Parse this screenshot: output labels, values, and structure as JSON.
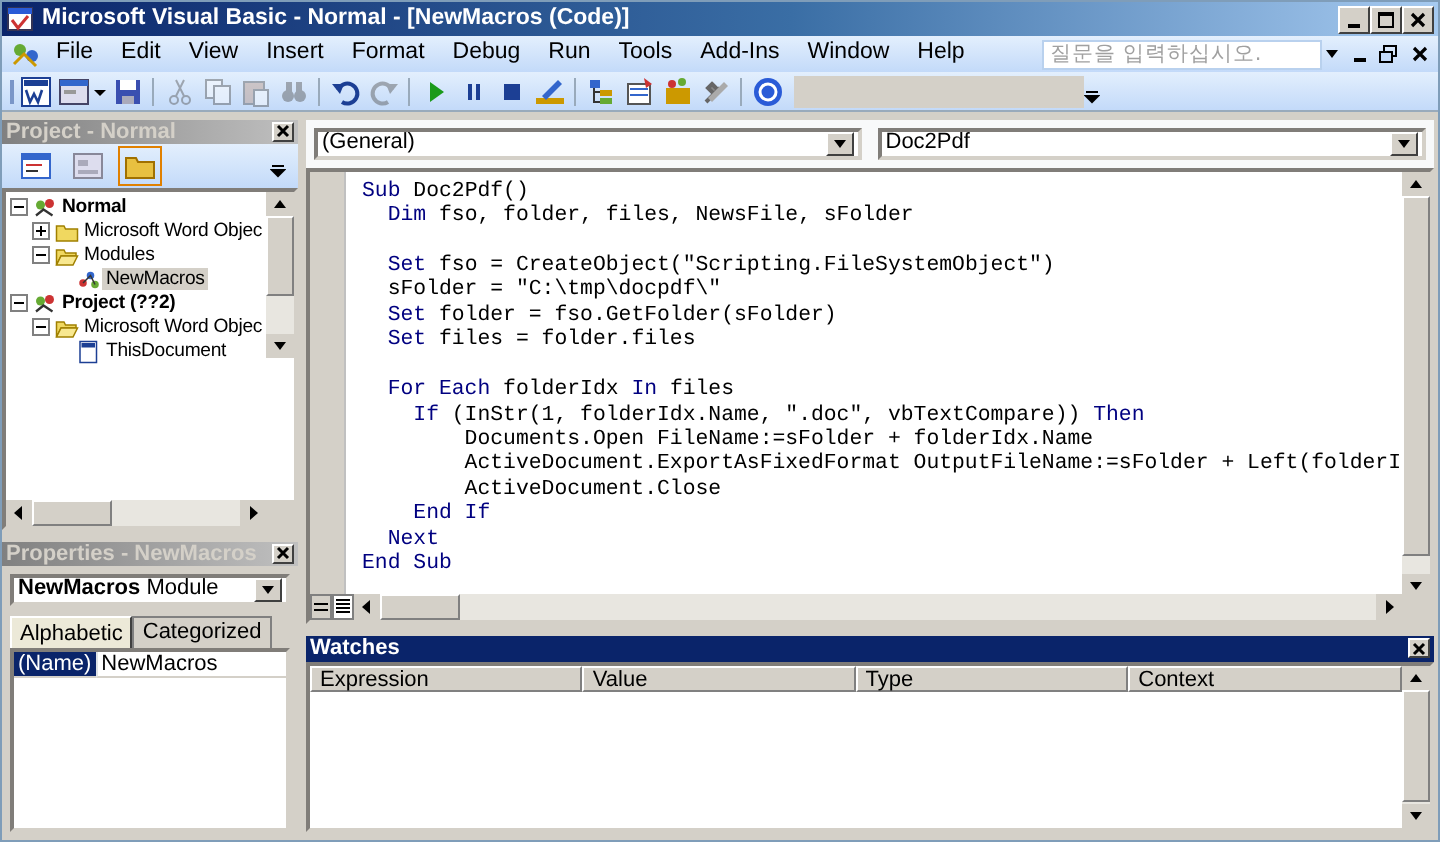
{
  "window": {
    "title": "Microsoft Visual Basic - Normal - [NewMacros (Code)]"
  },
  "menu": [
    "File",
    "Edit",
    "View",
    "Insert",
    "Format",
    "Debug",
    "Run",
    "Tools",
    "Add-Ins",
    "Window",
    "Help"
  ],
  "help_search": {
    "placeholder": "질문을 입력하십시오."
  },
  "toolbar": [
    {
      "kind": "word",
      "disabled": false
    },
    {
      "kind": "form",
      "disabled": false
    },
    {
      "kind": "save",
      "disabled": false
    },
    {
      "kind": "sep"
    },
    {
      "kind": "cut",
      "disabled": true
    },
    {
      "kind": "copy",
      "disabled": true
    },
    {
      "kind": "paste",
      "disabled": true
    },
    {
      "kind": "find",
      "disabled": true
    },
    {
      "kind": "sep"
    },
    {
      "kind": "undo",
      "disabled": false
    },
    {
      "kind": "redo",
      "disabled": true
    },
    {
      "kind": "sep"
    },
    {
      "kind": "run",
      "disabled": false
    },
    {
      "kind": "pause",
      "disabled": false
    },
    {
      "kind": "stop",
      "disabled": false
    },
    {
      "kind": "design",
      "disabled": false
    },
    {
      "kind": "sep"
    },
    {
      "kind": "explorer",
      "disabled": false
    },
    {
      "kind": "properties",
      "disabled": false
    },
    {
      "kind": "browser",
      "disabled": false
    },
    {
      "kind": "toolbox",
      "disabled": false
    },
    {
      "kind": "sep"
    },
    {
      "kind": "help",
      "disabled": false
    }
  ],
  "project_pane": {
    "title": "Project - Normal",
    "buttons": [
      {
        "kind": "view-code",
        "pressed": false
      },
      {
        "kind": "view-object",
        "pressed": false
      },
      {
        "kind": "toggle-folders",
        "pressed": true
      }
    ],
    "tree": [
      {
        "label": "Normal",
        "kind": "project",
        "expanded": true,
        "selected": false,
        "children": [
          {
            "label": "Microsoft Word Objec",
            "kind": "folder",
            "expanded": false,
            "selected": false
          },
          {
            "label": "Modules",
            "kind": "folder",
            "expanded": true,
            "selected": false,
            "children": [
              {
                "label": "NewMacros",
                "kind": "module",
                "selected": true
              }
            ]
          }
        ]
      },
      {
        "label": "Project (??2)",
        "kind": "project",
        "expanded": true,
        "selected": false,
        "children": [
          {
            "label": "Microsoft Word Objec",
            "kind": "folder",
            "expanded": true,
            "selected": false,
            "children": [
              {
                "label": "ThisDocument",
                "kind": "document",
                "selected": false
              }
            ]
          }
        ]
      }
    ]
  },
  "properties_pane": {
    "title": "Properties - NewMacros",
    "object": "**NewMacros** Module",
    "tabs": [
      {
        "label": "Alphabetic",
        "selected": true
      },
      {
        "label": "Categorized",
        "selected": false
      }
    ],
    "rows": [
      {
        "name": "(Name)",
        "value": "NewMacros",
        "selected": true
      }
    ]
  },
  "code_window": {
    "object": "(General)",
    "procedure": "Doc2Pdf",
    "lines": [
      {
        "kind": "code",
        "segments": [
          {
            "kind": "keyword",
            "text": "Sub"
          },
          {
            "kind": "plain",
            "text": " Doc2Pdf()"
          }
        ]
      },
      {
        "kind": "code",
        "segments": [
          {
            "kind": "keyword",
            "text": "  Dim"
          },
          {
            "kind": "plain",
            "text": " fso, folder, files, NewsFile, sFolder"
          }
        ]
      },
      {
        "kind": "blank"
      },
      {
        "kind": "code",
        "segments": [
          {
            "kind": "keyword",
            "text": "  Set"
          },
          {
            "kind": "plain",
            "text": " fso = CreateObject(\"Scripting.FileSystemObject\")"
          }
        ]
      },
      {
        "kind": "code",
        "segments": [
          {
            "kind": "plain",
            "text": "  sFolder = \"C:\\tmp\\docpdf\\\""
          }
        ]
      },
      {
        "kind": "code",
        "segments": [
          {
            "kind": "keyword",
            "text": "  Set"
          },
          {
            "kind": "plain",
            "text": " folder = fso.GetFolder(sFolder)"
          }
        ]
      },
      {
        "kind": "code",
        "segments": [
          {
            "kind": "keyword",
            "text": "  Set"
          },
          {
            "kind": "plain",
            "text": " files = folder.files"
          }
        ]
      },
      {
        "kind": "blank"
      },
      {
        "kind": "code",
        "segments": [
          {
            "kind": "keyword",
            "text": "  For Each"
          },
          {
            "kind": "plain",
            "text": " folderIdx "
          },
          {
            "kind": "keyword",
            "text": "In"
          },
          {
            "kind": "plain",
            "text": " files"
          }
        ]
      },
      {
        "kind": "code",
        "segments": [
          {
            "kind": "keyword",
            "text": "    If"
          },
          {
            "kind": "plain",
            "text": " (InStr(1, folderIdx.Name, \".doc\", vbTextCompare)) "
          },
          {
            "kind": "keyword",
            "text": "Then"
          }
        ]
      },
      {
        "kind": "code",
        "segments": [
          {
            "kind": "plain",
            "text": "        Documents.Open FileName:=sFolder + folderIdx.Name"
          }
        ]
      },
      {
        "kind": "code",
        "segments": [
          {
            "kind": "plain",
            "text": "        ActiveDocument.ExportAsFixedFormat OutputFileName:=sFolder + Left(folderI"
          }
        ]
      },
      {
        "kind": "code",
        "segments": [
          {
            "kind": "plain",
            "text": "        ActiveDocument.Close"
          }
        ]
      },
      {
        "kind": "code",
        "segments": [
          {
            "kind": "keyword",
            "text": "    End If"
          }
        ]
      },
      {
        "kind": "code",
        "segments": [
          {
            "kind": "keyword",
            "text": "  Next"
          }
        ]
      },
      {
        "kind": "code",
        "segments": [
          {
            "kind": "keyword",
            "text": "End Sub"
          }
        ]
      }
    ]
  },
  "watches": {
    "title": "Watches",
    "columns": [
      "Expression",
      "Value",
      "Type",
      "Context"
    ]
  }
}
